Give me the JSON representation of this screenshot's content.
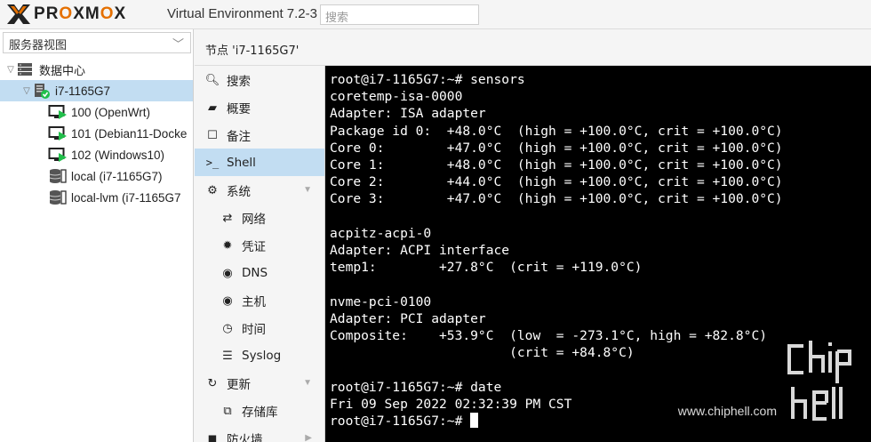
{
  "app": {
    "brand": "PROXMOX",
    "product": "Virtual Environment 7.2-3",
    "accent": "#e57000"
  },
  "search": {
    "placeholder": "搜索"
  },
  "sidebar": {
    "view_selector": "服务器视图",
    "tree": [
      {
        "label": "数据中心",
        "icon": "datacenter-icon",
        "level": 0,
        "expanded": true
      },
      {
        "label": "i7-1165G7",
        "icon": "node-online-icon",
        "level": 1,
        "expanded": true,
        "selected": true
      },
      {
        "label": "100 (OpenWrt)",
        "icon": "vm-running-icon",
        "level": 2
      },
      {
        "label": "101 (Debian11-Docke",
        "icon": "vm-running-icon",
        "level": 2
      },
      {
        "label": "102 (Windows10)",
        "icon": "vm-running-icon",
        "level": 2
      },
      {
        "label": "local (i7-1165G7)",
        "icon": "storage-icon",
        "level": 2
      },
      {
        "label": "local-lvm (i7-1165G7",
        "icon": "storage-icon",
        "level": 2
      }
    ]
  },
  "content": {
    "header": "节点 'i7-1165G7'"
  },
  "menu": [
    {
      "label": "搜索",
      "icon": "search-icon",
      "glyph": "🔍︎"
    },
    {
      "label": "概要",
      "icon": "book-icon",
      "glyph": "▰"
    },
    {
      "label": "备注",
      "icon": "notes-icon",
      "glyph": "☐"
    },
    {
      "label": "Shell",
      "icon": "terminal-icon",
      "glyph": ">_",
      "selected": true
    },
    {
      "label": "系统",
      "icon": "gears-icon",
      "glyph": "⚙",
      "arrow": "▼"
    },
    {
      "label": "网络",
      "icon": "exchange-icon",
      "glyph": "⇄",
      "sub": true
    },
    {
      "label": "凭证",
      "icon": "certificate-icon",
      "glyph": "✹",
      "sub": true
    },
    {
      "label": "DNS",
      "icon": "globe-icon",
      "glyph": "◉",
      "sub": true
    },
    {
      "label": "主机",
      "icon": "globe-icon",
      "glyph": "◉",
      "sub": true
    },
    {
      "label": "时间",
      "icon": "clock-icon",
      "glyph": "◷",
      "sub": true
    },
    {
      "label": "Syslog",
      "icon": "list-icon",
      "glyph": "☰",
      "sub": true
    },
    {
      "label": "更新",
      "icon": "refresh-icon",
      "glyph": "↻",
      "arrow": "▼"
    },
    {
      "label": "存储库",
      "icon": "files-icon",
      "glyph": "⧉",
      "sub": true
    },
    {
      "label": "防火墙",
      "icon": "shield-icon",
      "glyph": "◼",
      "arrow": "▶"
    }
  ],
  "terminal": {
    "lines": [
      "root@i7-1165G7:~# sensors",
      "coretemp-isa-0000",
      "Adapter: ISA adapter",
      "Package id 0:  +48.0°C  (high = +100.0°C, crit = +100.0°C)",
      "Core 0:        +47.0°C  (high = +100.0°C, crit = +100.0°C)",
      "Core 1:        +48.0°C  (high = +100.0°C, crit = +100.0°C)",
      "Core 2:        +44.0°C  (high = +100.0°C, crit = +100.0°C)",
      "Core 3:        +47.0°C  (high = +100.0°C, crit = +100.0°C)",
      "",
      "acpitz-acpi-0",
      "Adapter: ACPI interface",
      "temp1:        +27.8°C  (crit = +119.0°C)",
      "",
      "nvme-pci-0100",
      "Adapter: PCI adapter",
      "Composite:    +53.9°C  (low  = -273.1°C, high = +82.8°C)",
      "                       (crit = +84.8°C)",
      "",
      "root@i7-1165G7:~# date",
      "Fri 09 Sep 2022 02:32:39 PM CST"
    ],
    "prompt": "root@i7-1165G7:~# "
  },
  "watermark": {
    "url": "www.chiphell.com",
    "logo_text": "chiphell"
  }
}
